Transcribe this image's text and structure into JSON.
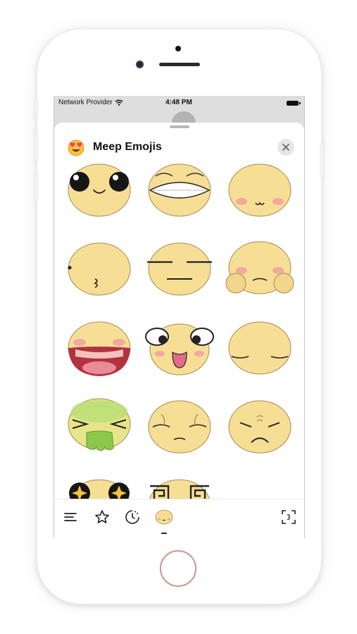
{
  "status_bar": {
    "carrier": "Network Provider",
    "time": "4:48 PM"
  },
  "header": {
    "title": "Meep Emojis",
    "app_icon": "heart-eyes-emoji-icon",
    "close_icon": "close-icon"
  },
  "stickers": [
    {
      "name": "big-eyes-smile"
    },
    {
      "name": "grin-squint"
    },
    {
      "name": "blush-smile"
    },
    {
      "name": "kiss"
    },
    {
      "name": "neutral-straight"
    },
    {
      "name": "cheeks-squish"
    },
    {
      "name": "open-mouth-wide"
    },
    {
      "name": "goofy-tongue"
    },
    {
      "name": "sleepy"
    },
    {
      "name": "sick-vomit"
    },
    {
      "name": "pained-relief"
    },
    {
      "name": "frown-worried"
    },
    {
      "name": "sparkle-eyes"
    },
    {
      "name": "spiral-eyes"
    }
  ],
  "toolbar": {
    "items": [
      "menu-icon",
      "favorites-star-icon",
      "recent-clock-icon",
      "meep-pack-icon",
      "expand-icon"
    ],
    "selected": "meep-pack-icon"
  },
  "colors": {
    "face_fill": "#F7DE95",
    "face_outline": "#A88A52",
    "blush": "#F2A9A0",
    "vomit": "#A6D86A"
  }
}
